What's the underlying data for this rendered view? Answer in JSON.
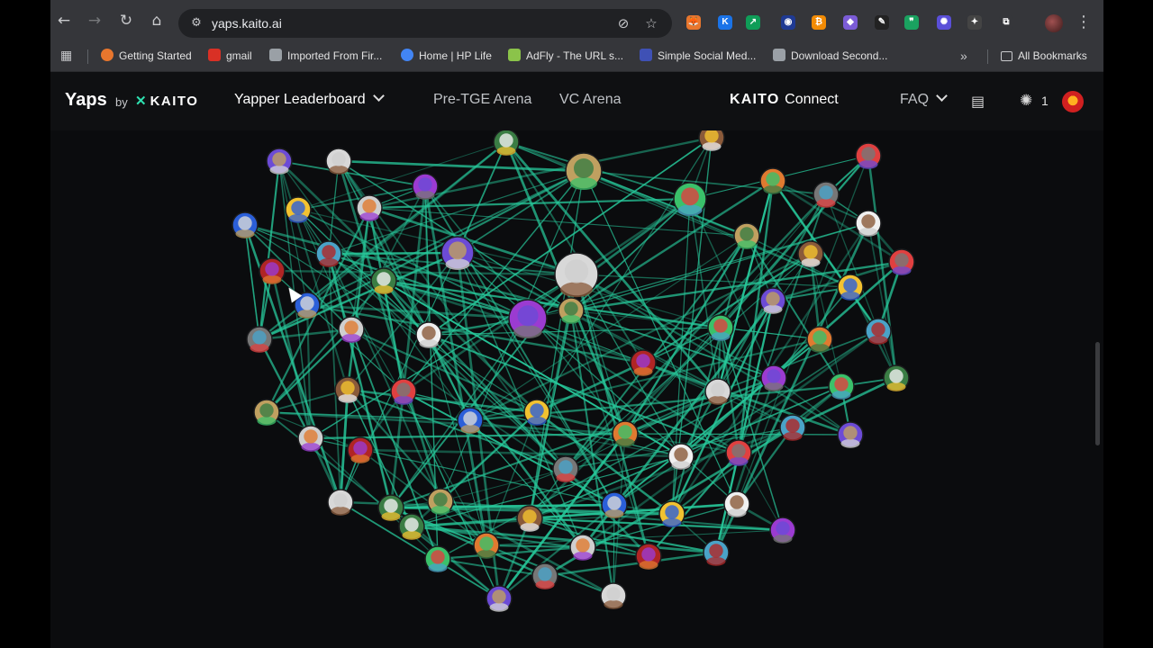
{
  "browser": {
    "url": "yaps.kaito.ai",
    "nav_icons": [
      "back-icon",
      "forward-icon",
      "reload-icon",
      "home-icon"
    ],
    "extensions": [
      {
        "name": "fox-extension",
        "color": "#e8762d",
        "glyph": "🦊"
      },
      {
        "name": "k-extension",
        "color": "#1a73e8",
        "glyph": "K"
      },
      {
        "name": "chart-extension",
        "color": "#0f9d58",
        "glyph": "↗"
      },
      {
        "name": "orb-extension",
        "color": "#1f3a93",
        "glyph": "◉"
      },
      {
        "name": "coin-extension",
        "color": "#f28b05",
        "glyph": "₿"
      },
      {
        "name": "game-extension",
        "color": "#7b5cd6",
        "glyph": "◆"
      },
      {
        "name": "pen-extension",
        "color": "#222222",
        "glyph": "✎"
      },
      {
        "name": "quote-extension",
        "color": "#1aa260",
        "glyph": "❞"
      },
      {
        "name": "gear-extension",
        "color": "#5a4fd8",
        "glyph": "✺"
      },
      {
        "name": "ai-extension",
        "color": "#444444",
        "glyph": "✦"
      },
      {
        "name": "puzzle-extension",
        "color": "#35363a",
        "glyph": "⧉"
      }
    ]
  },
  "bookmarks": [
    {
      "label": "Getting Started",
      "color": "#e8762d"
    },
    {
      "label": "gmail",
      "color": "#d93025"
    },
    {
      "label": "Imported From Fir...",
      "color": "#9aa0a6"
    },
    {
      "label": "Home | HP Life",
      "color": "#4285f4"
    },
    {
      "label": "AdFly - The URL s...",
      "color": "#8bc34a"
    },
    {
      "label": "Simple Social Med...",
      "color": "#3f51b5"
    },
    {
      "label": "Download Second...",
      "color": "#9aa0a6"
    }
  ],
  "bookmarks_overflow": "»",
  "all_bookmarks": "All Bookmarks",
  "site": {
    "logo_yaps": "Yaps",
    "logo_by": "by",
    "logo_kaito": "KAITO",
    "nav": {
      "leaderboard": "Yapper Leaderboard",
      "pretge": "Pre-TGE Arena",
      "vc": "VC Arena",
      "connect_brand": "KAITO",
      "connect_word": "Connect",
      "faq": "FAQ"
    },
    "notif_count": "1",
    "accent": "#2ee0b0"
  },
  "graph": {
    "edge_color": "#27c79a",
    "node_colors": [
      "#6c4bd6",
      "#d8d8d8",
      "#3a7d44",
      "#c0a060",
      "#8a5a3a",
      "#e04040",
      "#2b5fd9",
      "#f2c230",
      "#cfcfcf",
      "#9b3bd1",
      "#3ac16a",
      "#e07a30",
      "#777777",
      "#f0f0f0",
      "#b02525",
      "#4aa3c8"
    ],
    "nodes": [
      {
        "name": "avatar-purple-ring"
      },
      {
        "name": "avatar-pale-face"
      },
      {
        "name": "avatar-green-frog"
      },
      {
        "name": "avatar-eagle"
      },
      {
        "name": "avatar-white-dog"
      },
      {
        "name": "avatar-grey-box"
      },
      {
        "name": "avatar-anime"
      },
      {
        "name": "avatar-bald-man"
      },
      {
        "name": "avatar-suited-man"
      },
      {
        "name": "avatar-gold-mask"
      },
      {
        "name": "avatar-dark-hair"
      },
      {
        "name": "avatar-white-hair"
      },
      {
        "name": "avatar-blue-monster"
      },
      {
        "name": "avatar-tools-logo"
      },
      {
        "name": "avatar-yellow-face"
      },
      {
        "name": "avatar-punk"
      },
      {
        "name": "avatar-penguin"
      },
      {
        "name": "avatar-white-mask"
      },
      {
        "name": "avatar-spider"
      },
      {
        "name": "avatar-grey-default"
      },
      {
        "name": "avatar-pink-robot"
      },
      {
        "name": "avatar-sunglasses"
      },
      {
        "name": "avatar-blue-cat"
      },
      {
        "name": "avatar-blue-ring"
      },
      {
        "name": "avatar-pepe-hat"
      },
      {
        "name": "avatar-monkey-black"
      },
      {
        "name": "avatar-purple-ball"
      },
      {
        "name": "avatar-red-bear"
      },
      {
        "name": "avatar-woman"
      },
      {
        "name": "avatar-striped"
      },
      {
        "name": "avatar-gold-hair"
      },
      {
        "name": "avatar-blue-pixel"
      },
      {
        "name": "avatar-purple-hood"
      },
      {
        "name": "avatar-monkey-green"
      },
      {
        "name": "avatar-bearded-man"
      },
      {
        "name": "avatar-magenta"
      },
      {
        "name": "avatar-green-ring"
      },
      {
        "name": "avatar-fox"
      },
      {
        "name": "avatar-dark-man"
      },
      {
        "name": "avatar-white-bird"
      },
      {
        "name": "avatar-alien"
      },
      {
        "name": "avatar-blonde"
      },
      {
        "name": "avatar-man-beard"
      },
      {
        "name": "avatar-red-ring-cat"
      },
      {
        "name": "avatar-blue-mask"
      },
      {
        "name": "avatar-orange-cap"
      },
      {
        "name": "avatar-grey-wolf"
      },
      {
        "name": "avatar-dark-suit"
      },
      {
        "name": "avatar-pink-bunny"
      },
      {
        "name": "avatar-red-glasses"
      },
      {
        "name": "avatar-teal-hat"
      },
      {
        "name": "avatar-robot-gold"
      },
      {
        "name": "avatar-cyan-ring"
      },
      {
        "name": "avatar-black-man"
      },
      {
        "name": "avatar-masked-man"
      },
      {
        "name": "avatar-white-penguin"
      },
      {
        "name": "avatar-grey-pixel"
      },
      {
        "name": "avatar-teal-cat"
      },
      {
        "name": "avatar-pink-cat"
      },
      {
        "name": "avatar-cap-man"
      },
      {
        "name": "avatar-green-punk"
      },
      {
        "name": "avatar-small-grey"
      },
      {
        "name": "avatar-bearded-2"
      },
      {
        "name": "avatar-blue-robot"
      },
      {
        "name": "avatar-man-glasses"
      },
      {
        "name": "avatar-purple-pixel"
      },
      {
        "name": "avatar-glasses-small"
      },
      {
        "name": "avatar-head-white"
      }
    ]
  }
}
